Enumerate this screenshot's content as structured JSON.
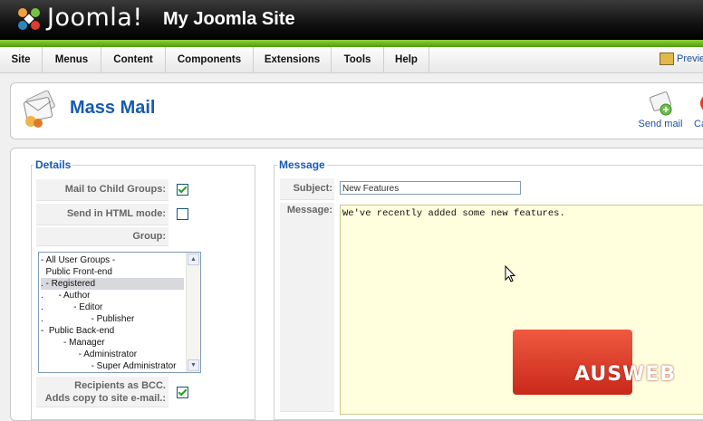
{
  "header": {
    "logo_text": "Joomla!",
    "site_title": "My Joomla Site"
  },
  "menubar": {
    "items": [
      "Site",
      "Menus",
      "Content",
      "Components",
      "Extensions",
      "Tools",
      "Help"
    ],
    "preview_label": "Preview"
  },
  "toolbar": {
    "title": "Mass Mail",
    "send_label": "Send mail",
    "cancel_label": "Ca"
  },
  "details": {
    "legend": "Details",
    "child_groups_label": "Mail to Child Groups:",
    "html_mode_label": "Send in HTML mode:",
    "group_label": "Group:",
    "groups": [
      "- All User Groups -",
      "  Public Front-end",
      ". - Registered",
      ".      - Author",
      ".            - Editor",
      ".                   - Publisher",
      "-  Public Back-end",
      "         - Manager",
      "               - Administrator",
      "                    - Super Administrator"
    ],
    "selected_group_index": 2,
    "recipients_label_1": "Recipients as BCC.",
    "recipients_label_2": "Adds copy to site e-mail.:",
    "child_groups_checked": true,
    "html_mode_checked": false,
    "bcc_checked": true
  },
  "message": {
    "legend": "Message",
    "subject_label": "Subject:",
    "subject_value": "New Features",
    "message_label": "Message:",
    "message_value": "We've recently added some new features."
  },
  "watermark": {
    "text": "AUSWEB"
  },
  "colors": {
    "accent": "#155ab6",
    "header_green": "#6fbd24",
    "message_bg": "#ffffdd"
  }
}
